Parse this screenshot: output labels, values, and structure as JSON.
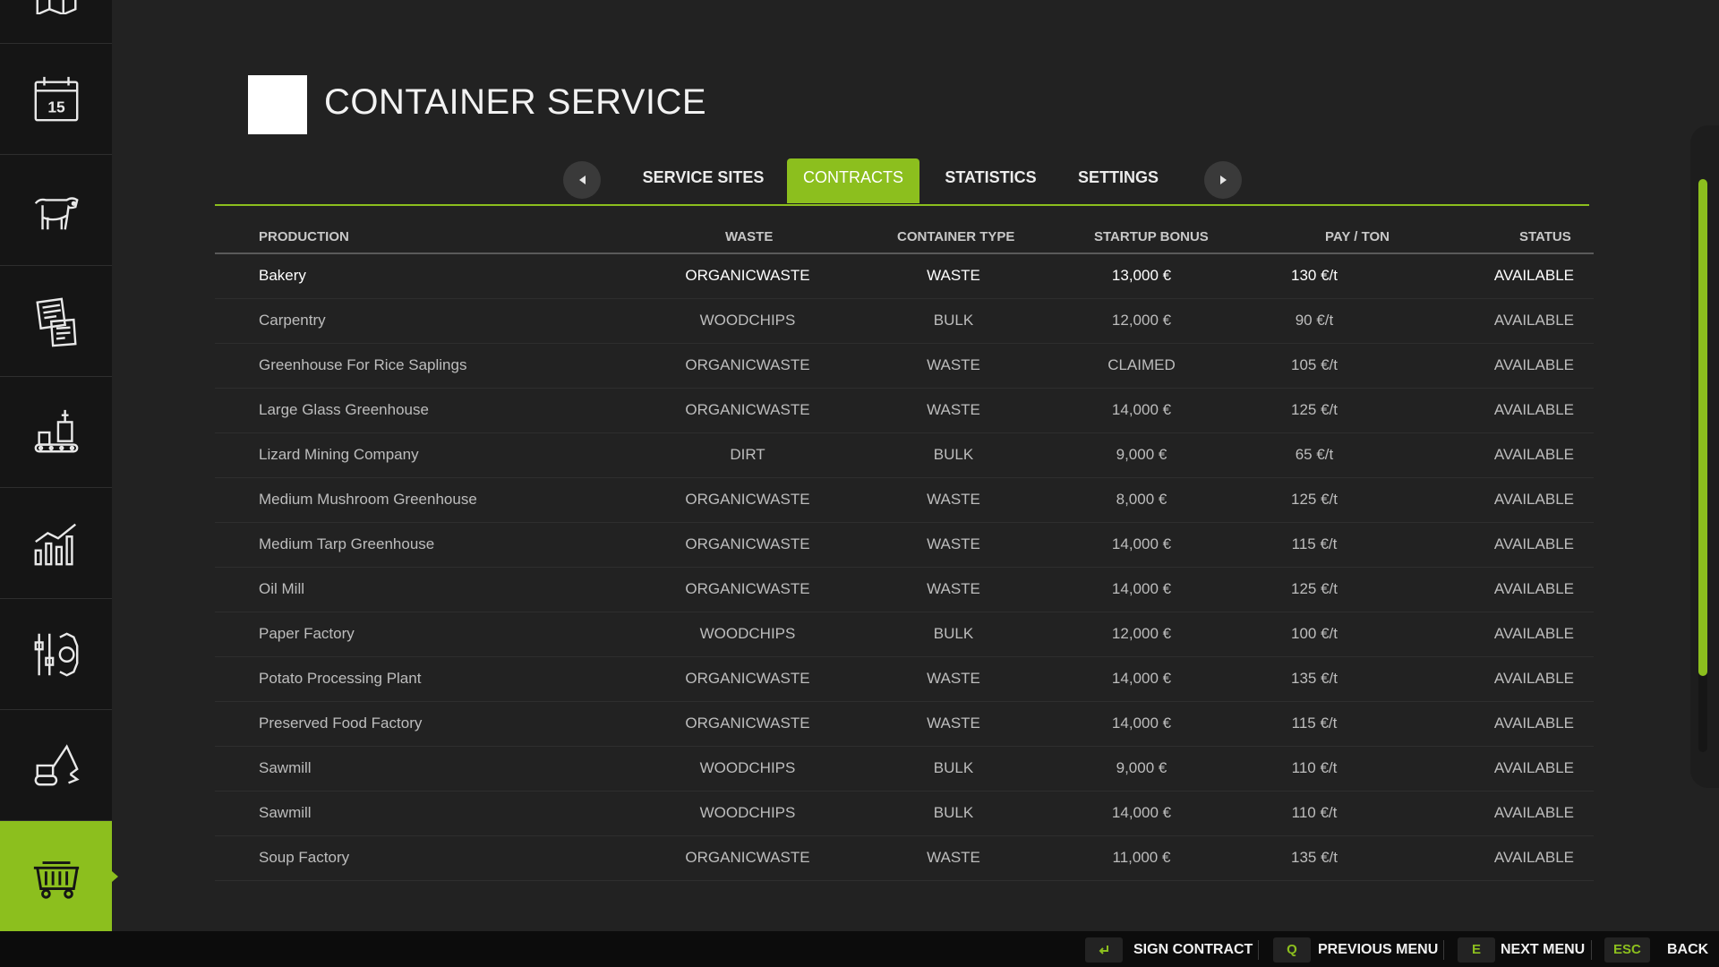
{
  "header": {
    "title": "CONTAINER SERVICE"
  },
  "tabs": [
    {
      "label": "SERVICE SITES",
      "active": false
    },
    {
      "label": "CONTRACTS",
      "active": true
    },
    {
      "label": "STATISTICS",
      "active": false
    },
    {
      "label": "SETTINGS",
      "active": false
    }
  ],
  "sidebar": {
    "items": [
      {
        "icon": "map-icon"
      },
      {
        "icon": "calendar-icon",
        "text": "15"
      },
      {
        "icon": "cow-icon"
      },
      {
        "icon": "contracts-icon"
      },
      {
        "icon": "production-icon"
      },
      {
        "icon": "statistics-icon"
      },
      {
        "icon": "settings-icon"
      },
      {
        "icon": "construction-icon"
      },
      {
        "icon": "container-icon",
        "active": true
      }
    ]
  },
  "table": {
    "headers": {
      "production": "PRODUCTION",
      "waste": "WASTE",
      "container_type": "CONTAINER TYPE",
      "startup_bonus": "STARTUP BONUS",
      "pay_ton": "PAY / TON",
      "status": "STATUS"
    },
    "rows": [
      {
        "production": "Bakery",
        "waste": "ORGANICWASTE",
        "type": "WASTE",
        "bonus": "13,000 €",
        "pay": "130 €/t",
        "status": "AVAILABLE"
      },
      {
        "production": "Carpentry",
        "waste": "WOODCHIPS",
        "type": "BULK",
        "bonus": "12,000 €",
        "pay": "90 €/t",
        "status": "AVAILABLE"
      },
      {
        "production": "Greenhouse For Rice Saplings",
        "waste": "ORGANICWASTE",
        "type": "WASTE",
        "bonus": "CLAIMED",
        "pay": "105 €/t",
        "status": "AVAILABLE"
      },
      {
        "production": "Large Glass Greenhouse",
        "waste": "ORGANICWASTE",
        "type": "WASTE",
        "bonus": "14,000 €",
        "pay": "125 €/t",
        "status": "AVAILABLE"
      },
      {
        "production": "Lizard Mining Company",
        "waste": "DIRT",
        "type": "BULK",
        "bonus": "9,000 €",
        "pay": "65 €/t",
        "status": "AVAILABLE"
      },
      {
        "production": "Medium Mushroom Greenhouse",
        "waste": "ORGANICWASTE",
        "type": "WASTE",
        "bonus": "8,000 €",
        "pay": "125 €/t",
        "status": "AVAILABLE"
      },
      {
        "production": "Medium Tarp Greenhouse",
        "waste": "ORGANICWASTE",
        "type": "WASTE",
        "bonus": "14,000 €",
        "pay": "115 €/t",
        "status": "AVAILABLE"
      },
      {
        "production": "Oil Mill",
        "waste": "ORGANICWASTE",
        "type": "WASTE",
        "bonus": "14,000 €",
        "pay": "125 €/t",
        "status": "AVAILABLE"
      },
      {
        "production": "Paper Factory",
        "waste": "WOODCHIPS",
        "type": "BULK",
        "bonus": "12,000 €",
        "pay": "100 €/t",
        "status": "AVAILABLE"
      },
      {
        "production": "Potato Processing Plant",
        "waste": "ORGANICWASTE",
        "type": "WASTE",
        "bonus": "14,000 €",
        "pay": "135 €/t",
        "status": "AVAILABLE"
      },
      {
        "production": "Preserved Food Factory",
        "waste": "ORGANICWASTE",
        "type": "WASTE",
        "bonus": "14,000 €",
        "pay": "115 €/t",
        "status": "AVAILABLE"
      },
      {
        "production": "Sawmill",
        "waste": "WOODCHIPS",
        "type": "BULK",
        "bonus": "9,000 €",
        "pay": "110 €/t",
        "status": "AVAILABLE"
      },
      {
        "production": "Sawmill",
        "waste": "WOODCHIPS",
        "type": "BULK",
        "bonus": "14,000 €",
        "pay": "110 €/t",
        "status": "AVAILABLE"
      },
      {
        "production": "Soup Factory",
        "waste": "ORGANICWASTE",
        "type": "WASTE",
        "bonus": "11,000 €",
        "pay": "135 €/t",
        "status": "AVAILABLE"
      }
    ]
  },
  "footer": {
    "sign_icon": "enter-icon",
    "sign_label": "SIGN CONTRACT",
    "prev_key": "Q",
    "prev_label": "PREVIOUS MENU",
    "next_key": "E",
    "next_label": "NEXT MENU",
    "back_key": "ESC",
    "back_label": "BACK"
  },
  "colors": {
    "accent": "#8cbf1e",
    "background": "#222222",
    "sidebar": "#151515"
  }
}
